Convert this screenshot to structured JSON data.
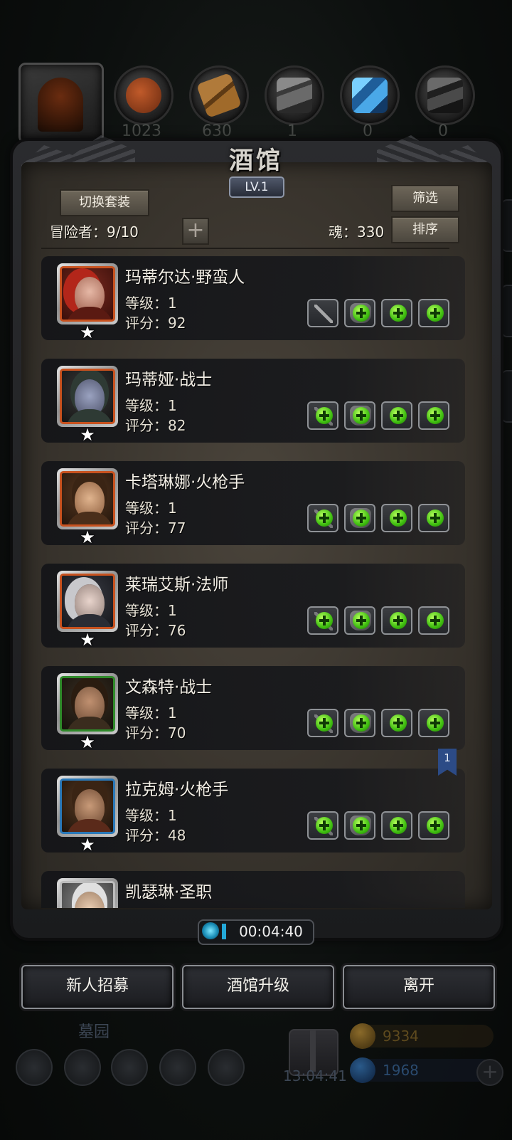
{
  "top_bar": {
    "resources": [
      {
        "icon": "meat-icon",
        "count": "1023"
      },
      {
        "icon": "wood-icon",
        "count": "630"
      },
      {
        "icon": "iron-ingot-icon",
        "count": "1"
      },
      {
        "icon": "crystal-icon",
        "count": "0"
      },
      {
        "icon": "dark-ingot-icon",
        "count": "0"
      }
    ]
  },
  "tavern": {
    "title": "酒馆",
    "level": "LV.1",
    "switch_outfit_label": "切换套装",
    "filter_label": "筛选",
    "sort_label": "排序",
    "adventurers_label": "冒险者：9/10",
    "soul_label": "魂：330",
    "add_label": "+"
  },
  "heroes": [
    {
      "name": "玛蒂尔达·野蛮人",
      "level": "等级：1",
      "score": "评分：92",
      "frame_color": "#c8521f",
      "first_slot": "equipped"
    },
    {
      "name": "玛蒂娅·战士",
      "level": "等级：1",
      "score": "评分：82",
      "frame_color": "#c8521f",
      "first_slot": "add"
    },
    {
      "name": "卡塔琳娜·火枪手",
      "level": "等级：1",
      "score": "评分：77",
      "frame_color": "#c8521f",
      "first_slot": "add"
    },
    {
      "name": "莱瑞艾斯·法师",
      "level": "等级：1",
      "score": "评分：76",
      "frame_color": "#c8521f",
      "first_slot": "add"
    },
    {
      "name": "文森特·战士",
      "level": "等级：1",
      "score": "评分：70",
      "frame_color": "#2f8a2a",
      "first_slot": "add"
    },
    {
      "name": "拉克姆·火枪手",
      "level": "等级：1",
      "score": "评分：48",
      "frame_color": "#2a78b8",
      "first_slot": "add"
    },
    {
      "name": "凯瑟琳·圣职",
      "level": "",
      "score": "",
      "frame_color": "#bdbdbd",
      "first_slot": "add"
    }
  ],
  "page_marker": "1",
  "timer": {
    "value": "00:04:40"
  },
  "actions": {
    "recruit_label": "新人招募",
    "upgrade_label": "酒馆升级",
    "leave_label": "离开"
  },
  "background": {
    "location_label": "墓园",
    "gift_timer": "13:04:41",
    "gold": "9334",
    "gems": "1968"
  },
  "colors": {
    "accent_green": "#3fbf10",
    "panel_brown": "#39342d",
    "bookmark_blue": "#2c4b86"
  }
}
